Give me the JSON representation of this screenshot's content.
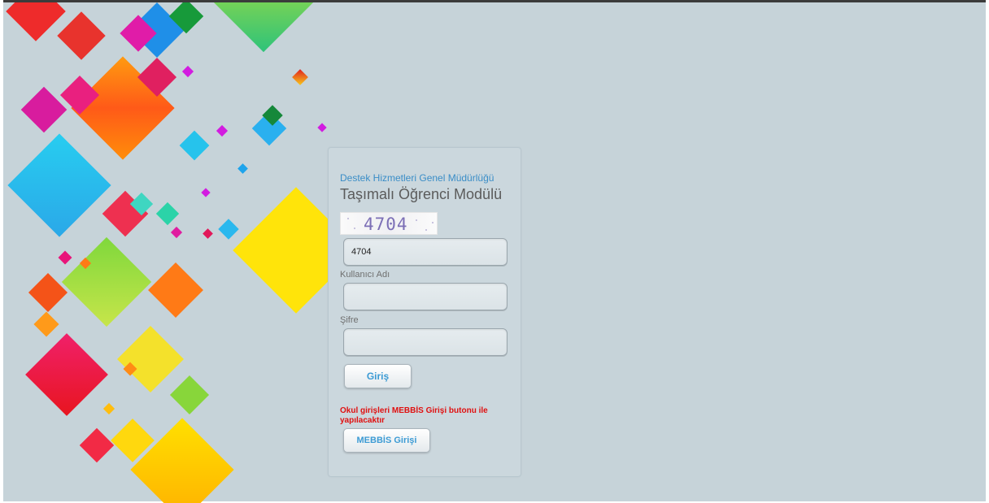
{
  "header": {
    "organization": "Destek Hizmetleri Genel Müdürlüğü",
    "title": "Taşımalı Öğrenci Modülü"
  },
  "captcha": {
    "image_text": "4704",
    "input_value": "4704"
  },
  "form": {
    "username_label": "Kullanıcı Adı",
    "username_value": "",
    "password_label": "Şifre",
    "password_value": "",
    "login_button": "Giriş"
  },
  "notice": {
    "text": "Okul girişleri MEBBİS Girişi butonu ile yapılacaktır"
  },
  "mebbis": {
    "button_label": "MEBBİS Girişi"
  },
  "colors": {
    "background": "#c6d3d9",
    "accent_blue": "#3a8dc7",
    "notice_red": "#e01010"
  }
}
